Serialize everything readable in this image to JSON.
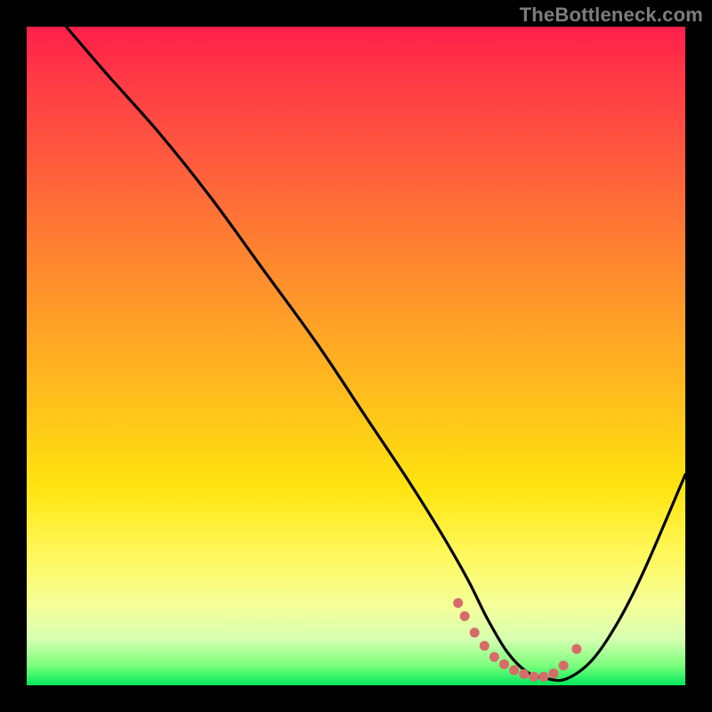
{
  "watermark": "TheBottleneck.com",
  "chart_data": {
    "type": "line",
    "title": "",
    "xlabel": "",
    "ylabel": "",
    "xlim": [
      0,
      100
    ],
    "ylim": [
      0,
      100
    ],
    "series": [
      {
        "name": "bottleneck-curve",
        "x": [
          0,
          6,
          12,
          20,
          28,
          36,
          44,
          52,
          58,
          63,
          67,
          70,
          73,
          76,
          79,
          82,
          86,
          90,
          94,
          100
        ],
        "values": [
          107,
          100,
          93,
          84,
          74,
          63,
          52,
          40,
          31,
          23,
          16,
          10,
          5,
          2,
          1,
          1,
          4,
          10,
          18,
          32
        ]
      }
    ],
    "highlight_points": {
      "name": "optimal-range-dots",
      "x": [
        65.5,
        66.5,
        68,
        69.5,
        71,
        72.5,
        74,
        75.5,
        77,
        78.5,
        80,
        81.5,
        83.5
      ],
      "values": [
        12.5,
        10.5,
        8.0,
        6.0,
        4.3,
        3.2,
        2.3,
        1.7,
        1.3,
        1.3,
        1.8,
        3.0,
        5.5
      ]
    },
    "gradient_stops": [
      {
        "pos": 0.0,
        "color": "#ff1f4b"
      },
      {
        "pos": 0.3,
        "color": "#ff7d33"
      },
      {
        "pos": 0.6,
        "color": "#ffd21b"
      },
      {
        "pos": 0.85,
        "color": "#f7ff8a"
      },
      {
        "pos": 1.0,
        "color": "#00e85a"
      }
    ]
  }
}
